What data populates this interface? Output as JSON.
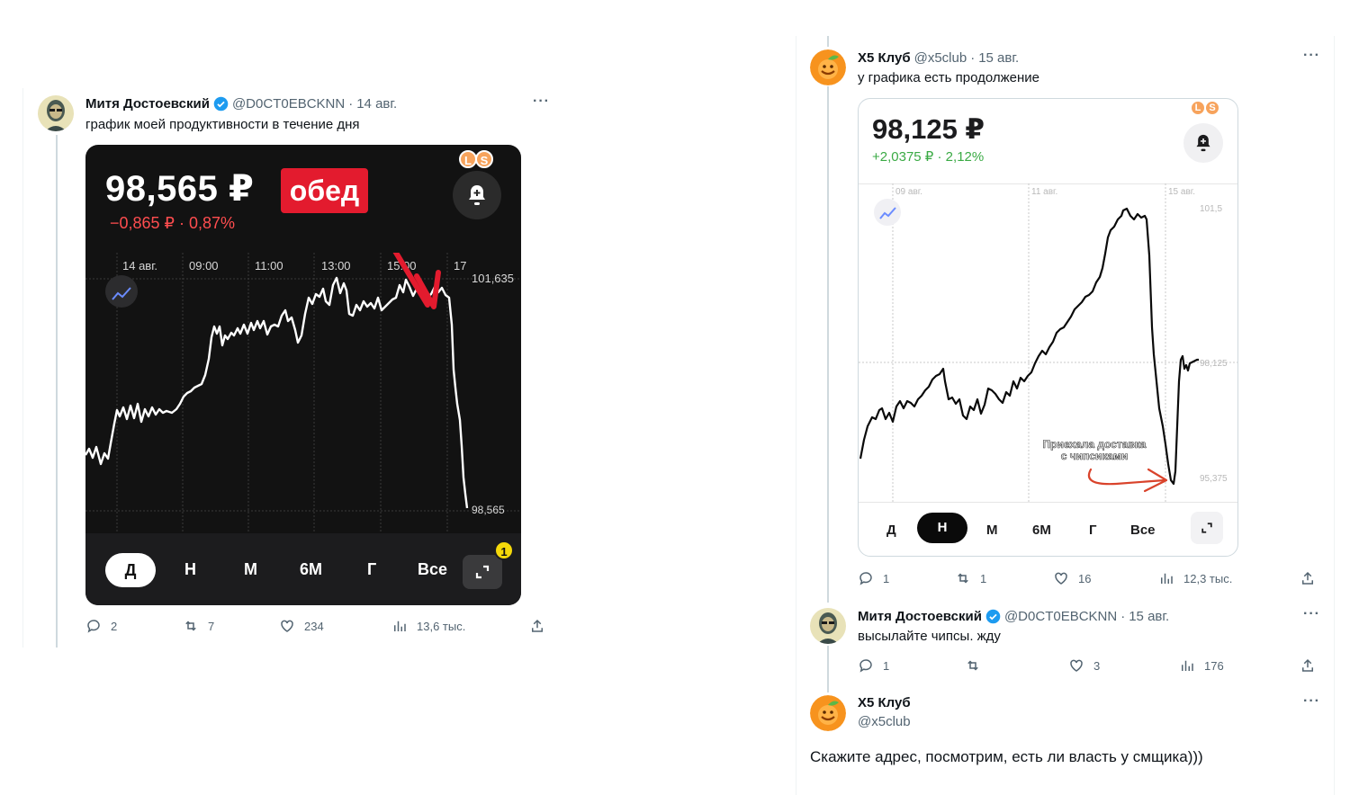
{
  "left_tweet": {
    "author_name": "Митя Достоевский",
    "handle": "@D0CT0EBCKNN",
    "date": "14 авг.",
    "text": "график моей продуктивности в течение дня",
    "counts": {
      "replies": "2",
      "retweets": "7",
      "likes": "234",
      "views": "13,6 тыс."
    },
    "card": {
      "price": "98,565 ₽",
      "change": "−0,865 ₽ · 0,87%",
      "sticker": "обед",
      "ls_badge": [
        "L",
        "S"
      ],
      "time_labels": [
        "14 авг.",
        "09:00",
        "11:00",
        "13:00",
        "15:00",
        "17"
      ],
      "price_high_label": "101,635",
      "price_low_label": "98,565",
      "tabs": [
        "Д",
        "Н",
        "М",
        "6М",
        "Г",
        "Все"
      ],
      "active_tab": "Д",
      "notification_badge": "1",
      "line_color": "#ffffff",
      "background": "#121212",
      "arrow_color": "#e31b2e"
    }
  },
  "right_tweet": {
    "author_name": "X5 Клуб",
    "handle": "@x5club",
    "date": "15 авг.",
    "text": "у графика есть продолжение",
    "counts": {
      "replies": "1",
      "retweets": "1",
      "likes": "16",
      "views": "12,3 тыс."
    },
    "card": {
      "price": "98,125 ₽",
      "change": "+2,0375 ₽ · 2,12%",
      "ls_badge": [
        "L",
        "S"
      ],
      "date_labels": [
        "09 авг.",
        "11 авг.",
        "15 авг."
      ],
      "price_labels": [
        "101,5",
        "98,125",
        "95,375"
      ],
      "annotation_line1": "Приехала доставка",
      "annotation_line2": "с чипсиками",
      "tabs": [
        "Д",
        "Н",
        "М",
        "6М",
        "Г",
        "Все"
      ],
      "active_tab": "Н",
      "line_color": "#0a0a0a",
      "arrow_color": "#d9432b"
    }
  },
  "reply_1": {
    "author_name": "Митя Достоевский",
    "handle": "@D0CT0EBCKNN",
    "date": "15 авг.",
    "text": "высылайте чипсы. жду",
    "counts": {
      "replies": "1",
      "retweets": "",
      "likes": "3",
      "views": "176"
    }
  },
  "reply_2": {
    "author_name": "X5 Клуб",
    "handle": "@x5club",
    "text": "Скажите адрес, посмотрим, есть ли власть у смщика)))"
  },
  "separator_dot": "·",
  "more_glyph": "···",
  "colors": {
    "verified_blue": "#1d9bf0",
    "text_secondary": "#536471",
    "x5_orange": "#f7931e",
    "x5_green": "#5cb848"
  }
}
